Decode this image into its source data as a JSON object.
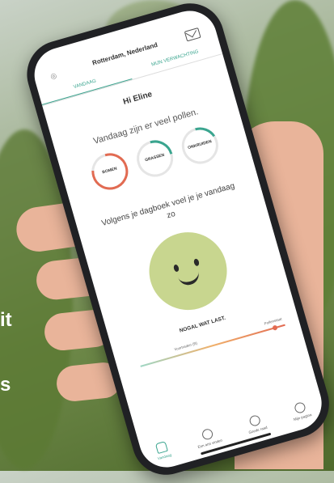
{
  "header": {
    "location": "Rotterdam, Nederland",
    "location_icon": "pin-icon",
    "mail_icon": "mail-icon"
  },
  "tabs": [
    {
      "label": "VANDAAG",
      "active": true
    },
    {
      "label": "MIJN VERWACHTING",
      "active": false
    }
  ],
  "greeting": "Hi Eline",
  "pollen_text": "Vandaag zijn er veel pollen.",
  "pollen_types": [
    {
      "label": "BOMEN",
      "level": 0.8,
      "color": "#e26b52"
    },
    {
      "label": "GRASSEN",
      "level": 0.25,
      "color": "#3aa58f"
    },
    {
      "label": "ONKRUIDEN",
      "level": 0.2,
      "color": "#3aa58f"
    }
  ],
  "diary_text": "Volgens je dagboek voel je je vandaag zo",
  "mood_status": "NOGAL WAT LAST.",
  "scale": {
    "left_label": "Voortraden (B)",
    "right_label": "Pollenstaat",
    "value": 0.93
  },
  "nav": [
    {
      "label": "Vandaag",
      "icon": "home-icon",
      "active": true
    },
    {
      "label": "Een arts vinden",
      "icon": "doctor-icon",
      "active": false
    },
    {
      "label": "Goede raad",
      "icon": "lightbulb-icon",
      "active": false
    },
    {
      "label": "Mijn pagina",
      "icon": "user-icon",
      "active": false
    }
  ],
  "side_text": [
    "it",
    "s"
  ]
}
